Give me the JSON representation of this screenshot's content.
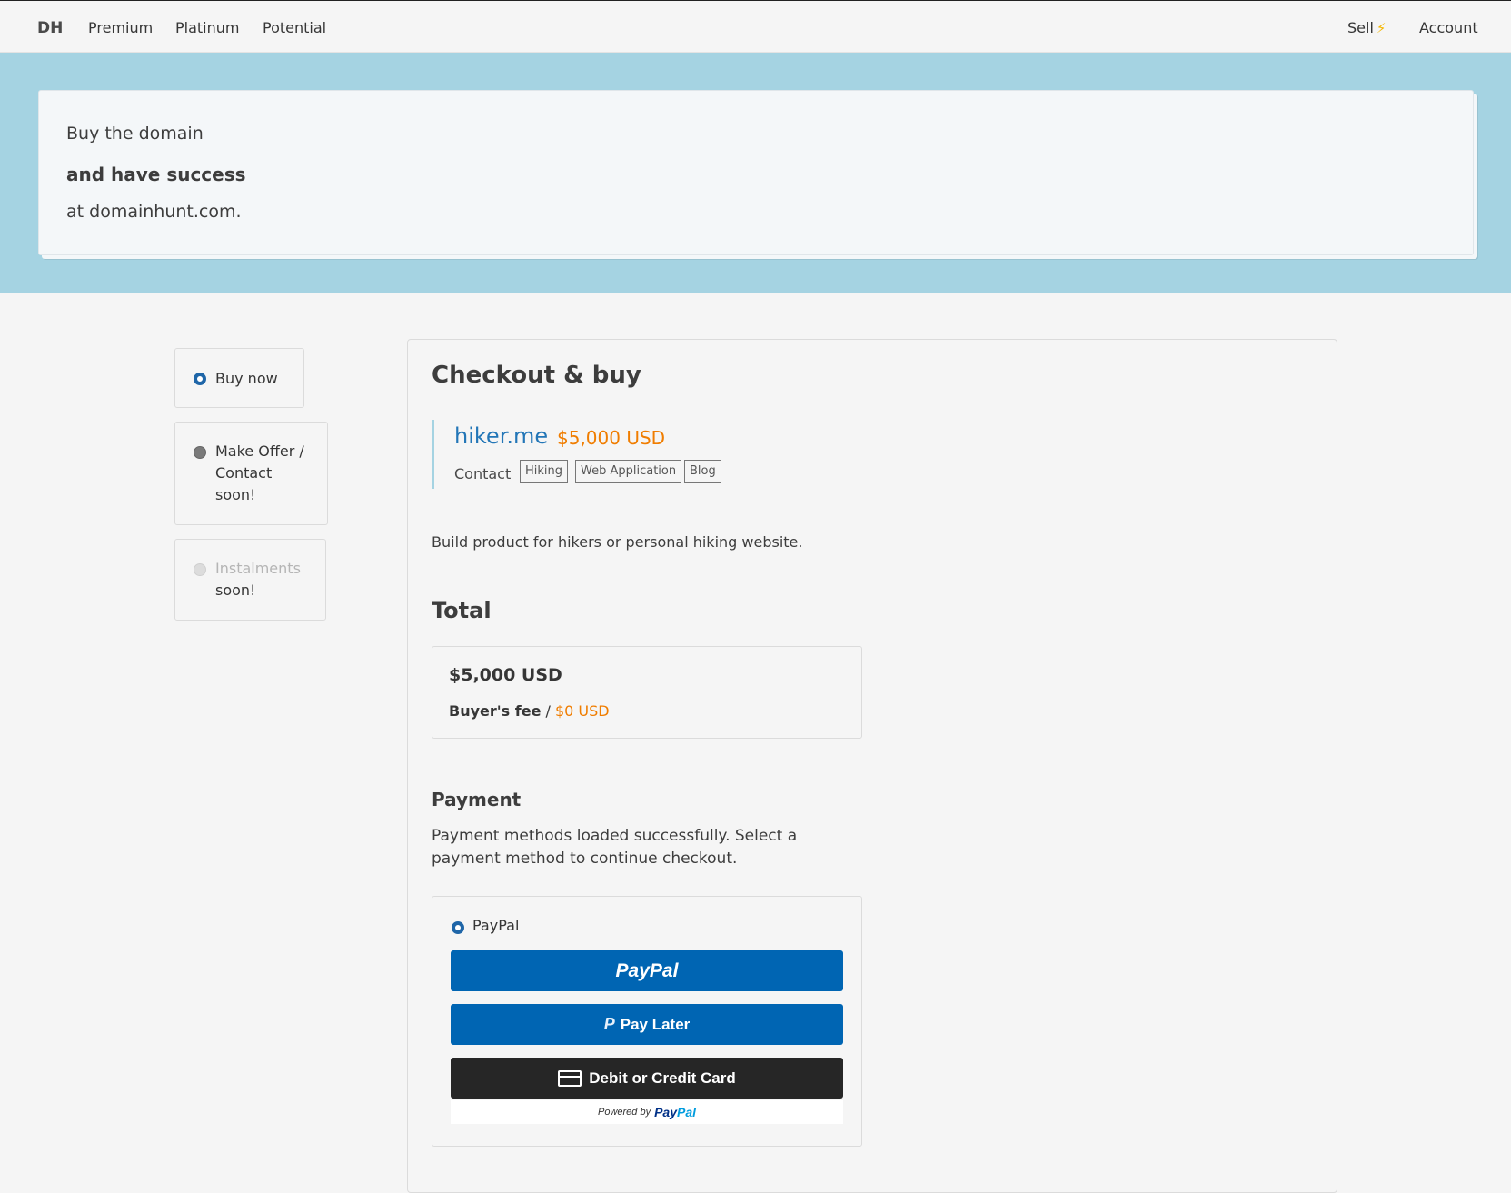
{
  "nav": {
    "brand": "DH",
    "links": [
      "Premium",
      "Platinum",
      "Potential"
    ],
    "sell": "Sell",
    "sell_icon": "lightning-icon",
    "account": "Account"
  },
  "hero": {
    "line1": "Buy the domain",
    "line2": "and have success",
    "line3": "at domainhunt.com."
  },
  "options": {
    "buy_now": "Buy now",
    "make_offer_l1": "Make Offer /",
    "make_offer_l2": "Contact",
    "make_offer_soon": "soon!",
    "instalments": "Instalments",
    "instalments_soon": "soon!"
  },
  "checkout": {
    "title": "Checkout & buy",
    "domain": "hiker.me",
    "price": "$5,000 USD",
    "contact": "Contact",
    "tags": [
      "Hiking",
      "Web Application",
      "Blog"
    ],
    "description": "Build product for hikers or personal hiking website."
  },
  "total": {
    "title": "Total",
    "amount": "$5,000 USD",
    "fee_label": "Buyer's fee",
    "fee_sep": " / ",
    "fee_value": "$0 USD"
  },
  "payment": {
    "title": "Payment",
    "message": "Payment methods loaded successfully. Select a payment method to continue checkout.",
    "method": "PayPal",
    "btn_paypal": "PayPal",
    "btn_pay_later": "Pay Later",
    "btn_card": "Debit or Credit Card",
    "powered_by": "Powered by",
    "powered_logo_a": "Pay",
    "powered_logo_b": "Pal"
  },
  "colors": {
    "accent_blue": "#1f66a8",
    "hero_bg": "#a5d3e2",
    "orange": "#f07d00",
    "paypal_blue": "#0065b3"
  }
}
